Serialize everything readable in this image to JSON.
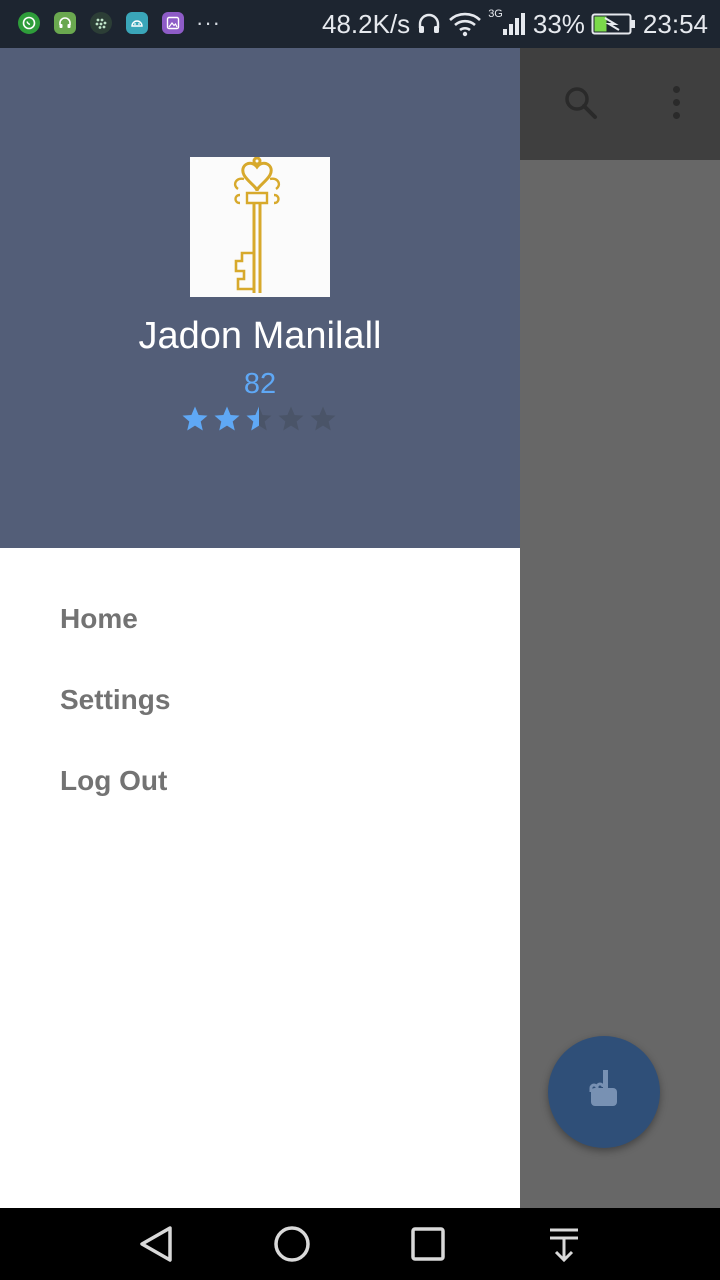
{
  "status_bar": {
    "notification_icons": [
      "whatsapp-icon",
      "headset-app-icon",
      "blackberry-icon",
      "android-icon",
      "image-icon"
    ],
    "more_glyph": "···",
    "network_speed": "48.2K/s",
    "network_type": "3G",
    "battery": "33%",
    "time": "23:54"
  },
  "toolbar": {
    "icons": [
      "search-icon",
      "overflow-menu-icon"
    ]
  },
  "drawer": {
    "user": {
      "name": "Jadon Manilall",
      "score": "82",
      "rating": 2.5,
      "rating_max": 5
    },
    "menu": [
      {
        "label": "Home"
      },
      {
        "label": "Settings"
      },
      {
        "label": "Log Out"
      }
    ]
  },
  "fab": {
    "icon": "hand-pointer-icon"
  },
  "nav_bar": {
    "buttons": [
      "back-icon",
      "home-icon",
      "recents-icon",
      "notification-pull-icon"
    ]
  },
  "colors": {
    "drawer_header": "#535e78",
    "accent_blue": "#5fa8f5",
    "menu_text": "#737373",
    "fab": "#2f4f78"
  }
}
